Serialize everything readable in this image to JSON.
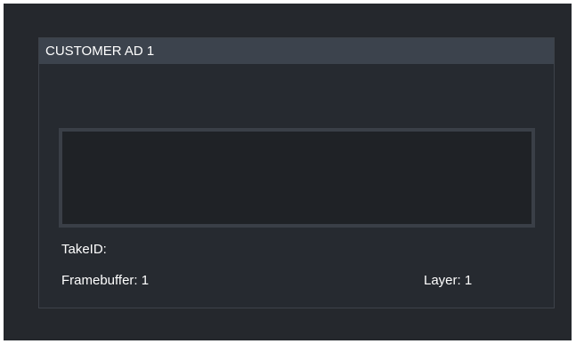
{
  "panel": {
    "title": "CUSTOMER AD 1",
    "take_id_label": "TakeID:",
    "framebuffer_label": "Framebuffer: 1",
    "layer_label": "Layer: 1"
  },
  "colors": {
    "background": "#25282d",
    "header": "#3c434d",
    "preview": "#1f2226",
    "text": "#ffffff"
  }
}
